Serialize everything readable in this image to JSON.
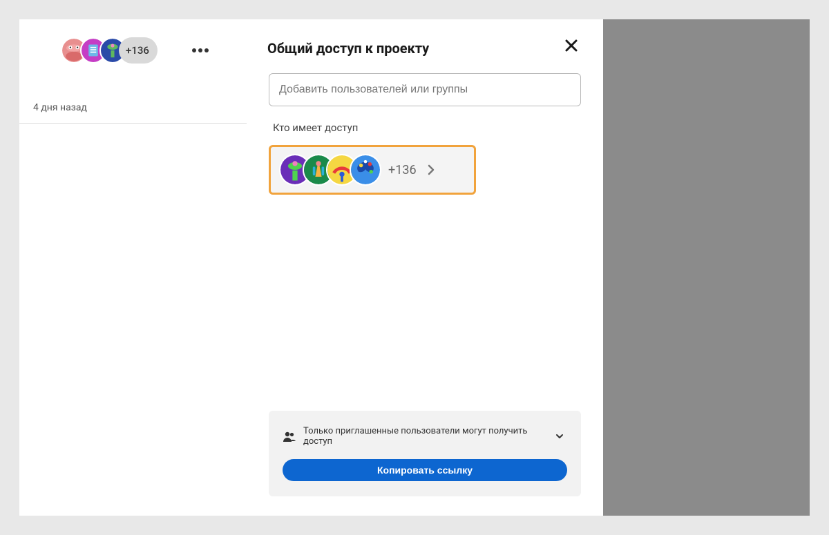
{
  "background": {
    "avatar_overflow": "+136",
    "date_line": "4 дня назад"
  },
  "modal": {
    "title": "Общий доступ к проекту",
    "add_placeholder": "Добавить пользователей или группы",
    "who_has_access": "Кто имеет доступ",
    "access_count": "+136",
    "footer_permission_text": "Только приглашенные пользователи могут получить доступ",
    "copy_link_label": "Копировать ссылку"
  }
}
